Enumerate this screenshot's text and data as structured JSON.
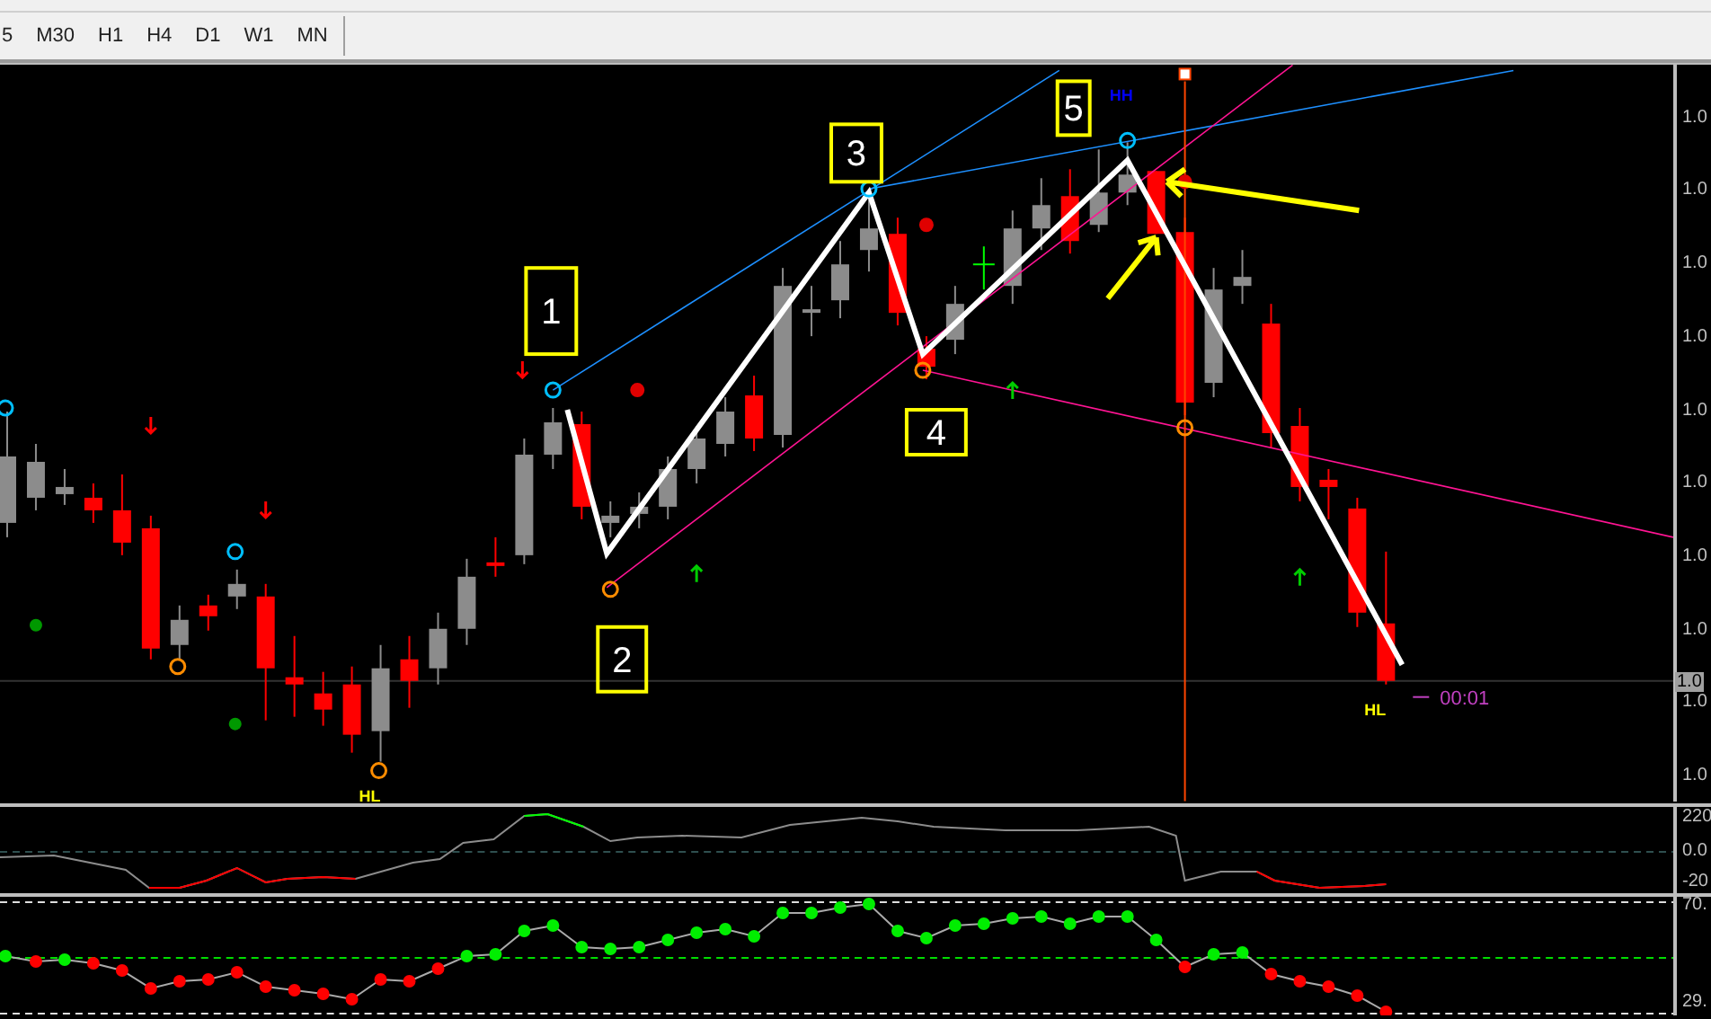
{
  "toolbar": {
    "timeframes": [
      {
        "label": "5"
      },
      {
        "label": "M30"
      },
      {
        "label": "H1"
      },
      {
        "label": "H4"
      },
      {
        "label": "D1"
      },
      {
        "label": "W1"
      },
      {
        "label": "MN"
      }
    ]
  },
  "chart": {
    "price_axis": [
      "1.0",
      "1.0",
      "1.0",
      "1.0",
      "1.0",
      "1.0",
      "1.0",
      "1.0",
      "1.0",
      "1.0"
    ],
    "current_price": "1.0",
    "wave_labels": [
      "1",
      "2",
      "3",
      "4",
      "5"
    ],
    "swing_labels": [
      {
        "text": "HH",
        "color": "#0000ff"
      },
      {
        "text": "HL",
        "color": "#ffff00"
      },
      {
        "text": "HL",
        "color": "#ffff00"
      }
    ],
    "timer": "00:01"
  },
  "indicator_1": {
    "axis": [
      "220",
      "0.0",
      "-20"
    ]
  },
  "indicator_2": {
    "axis": [
      "70.",
      "29."
    ]
  }
}
